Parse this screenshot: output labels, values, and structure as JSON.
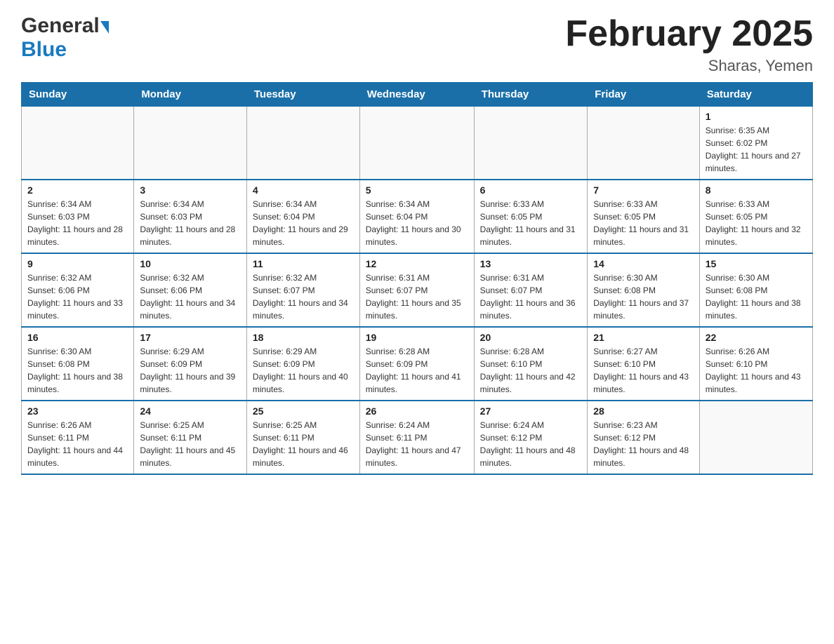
{
  "header": {
    "logo_general": "General",
    "logo_blue": "Blue",
    "month_title": "February 2025",
    "location": "Sharas, Yemen"
  },
  "days_of_week": [
    "Sunday",
    "Monday",
    "Tuesday",
    "Wednesday",
    "Thursday",
    "Friday",
    "Saturday"
  ],
  "weeks": [
    [
      {
        "num": "",
        "sunrise": "",
        "sunset": "",
        "daylight": ""
      },
      {
        "num": "",
        "sunrise": "",
        "sunset": "",
        "daylight": ""
      },
      {
        "num": "",
        "sunrise": "",
        "sunset": "",
        "daylight": ""
      },
      {
        "num": "",
        "sunrise": "",
        "sunset": "",
        "daylight": ""
      },
      {
        "num": "",
        "sunrise": "",
        "sunset": "",
        "daylight": ""
      },
      {
        "num": "",
        "sunrise": "",
        "sunset": "",
        "daylight": ""
      },
      {
        "num": "1",
        "sunrise": "Sunrise: 6:35 AM",
        "sunset": "Sunset: 6:02 PM",
        "daylight": "Daylight: 11 hours and 27 minutes."
      }
    ],
    [
      {
        "num": "2",
        "sunrise": "Sunrise: 6:34 AM",
        "sunset": "Sunset: 6:03 PM",
        "daylight": "Daylight: 11 hours and 28 minutes."
      },
      {
        "num": "3",
        "sunrise": "Sunrise: 6:34 AM",
        "sunset": "Sunset: 6:03 PM",
        "daylight": "Daylight: 11 hours and 28 minutes."
      },
      {
        "num": "4",
        "sunrise": "Sunrise: 6:34 AM",
        "sunset": "Sunset: 6:04 PM",
        "daylight": "Daylight: 11 hours and 29 minutes."
      },
      {
        "num": "5",
        "sunrise": "Sunrise: 6:34 AM",
        "sunset": "Sunset: 6:04 PM",
        "daylight": "Daylight: 11 hours and 30 minutes."
      },
      {
        "num": "6",
        "sunrise": "Sunrise: 6:33 AM",
        "sunset": "Sunset: 6:05 PM",
        "daylight": "Daylight: 11 hours and 31 minutes."
      },
      {
        "num": "7",
        "sunrise": "Sunrise: 6:33 AM",
        "sunset": "Sunset: 6:05 PM",
        "daylight": "Daylight: 11 hours and 31 minutes."
      },
      {
        "num": "8",
        "sunrise": "Sunrise: 6:33 AM",
        "sunset": "Sunset: 6:05 PM",
        "daylight": "Daylight: 11 hours and 32 minutes."
      }
    ],
    [
      {
        "num": "9",
        "sunrise": "Sunrise: 6:32 AM",
        "sunset": "Sunset: 6:06 PM",
        "daylight": "Daylight: 11 hours and 33 minutes."
      },
      {
        "num": "10",
        "sunrise": "Sunrise: 6:32 AM",
        "sunset": "Sunset: 6:06 PM",
        "daylight": "Daylight: 11 hours and 34 minutes."
      },
      {
        "num": "11",
        "sunrise": "Sunrise: 6:32 AM",
        "sunset": "Sunset: 6:07 PM",
        "daylight": "Daylight: 11 hours and 34 minutes."
      },
      {
        "num": "12",
        "sunrise": "Sunrise: 6:31 AM",
        "sunset": "Sunset: 6:07 PM",
        "daylight": "Daylight: 11 hours and 35 minutes."
      },
      {
        "num": "13",
        "sunrise": "Sunrise: 6:31 AM",
        "sunset": "Sunset: 6:07 PM",
        "daylight": "Daylight: 11 hours and 36 minutes."
      },
      {
        "num": "14",
        "sunrise": "Sunrise: 6:30 AM",
        "sunset": "Sunset: 6:08 PM",
        "daylight": "Daylight: 11 hours and 37 minutes."
      },
      {
        "num": "15",
        "sunrise": "Sunrise: 6:30 AM",
        "sunset": "Sunset: 6:08 PM",
        "daylight": "Daylight: 11 hours and 38 minutes."
      }
    ],
    [
      {
        "num": "16",
        "sunrise": "Sunrise: 6:30 AM",
        "sunset": "Sunset: 6:08 PM",
        "daylight": "Daylight: 11 hours and 38 minutes."
      },
      {
        "num": "17",
        "sunrise": "Sunrise: 6:29 AM",
        "sunset": "Sunset: 6:09 PM",
        "daylight": "Daylight: 11 hours and 39 minutes."
      },
      {
        "num": "18",
        "sunrise": "Sunrise: 6:29 AM",
        "sunset": "Sunset: 6:09 PM",
        "daylight": "Daylight: 11 hours and 40 minutes."
      },
      {
        "num": "19",
        "sunrise": "Sunrise: 6:28 AM",
        "sunset": "Sunset: 6:09 PM",
        "daylight": "Daylight: 11 hours and 41 minutes."
      },
      {
        "num": "20",
        "sunrise": "Sunrise: 6:28 AM",
        "sunset": "Sunset: 6:10 PM",
        "daylight": "Daylight: 11 hours and 42 minutes."
      },
      {
        "num": "21",
        "sunrise": "Sunrise: 6:27 AM",
        "sunset": "Sunset: 6:10 PM",
        "daylight": "Daylight: 11 hours and 43 minutes."
      },
      {
        "num": "22",
        "sunrise": "Sunrise: 6:26 AM",
        "sunset": "Sunset: 6:10 PM",
        "daylight": "Daylight: 11 hours and 43 minutes."
      }
    ],
    [
      {
        "num": "23",
        "sunrise": "Sunrise: 6:26 AM",
        "sunset": "Sunset: 6:11 PM",
        "daylight": "Daylight: 11 hours and 44 minutes."
      },
      {
        "num": "24",
        "sunrise": "Sunrise: 6:25 AM",
        "sunset": "Sunset: 6:11 PM",
        "daylight": "Daylight: 11 hours and 45 minutes."
      },
      {
        "num": "25",
        "sunrise": "Sunrise: 6:25 AM",
        "sunset": "Sunset: 6:11 PM",
        "daylight": "Daylight: 11 hours and 46 minutes."
      },
      {
        "num": "26",
        "sunrise": "Sunrise: 6:24 AM",
        "sunset": "Sunset: 6:11 PM",
        "daylight": "Daylight: 11 hours and 47 minutes."
      },
      {
        "num": "27",
        "sunrise": "Sunrise: 6:24 AM",
        "sunset": "Sunset: 6:12 PM",
        "daylight": "Daylight: 11 hours and 48 minutes."
      },
      {
        "num": "28",
        "sunrise": "Sunrise: 6:23 AM",
        "sunset": "Sunset: 6:12 PM",
        "daylight": "Daylight: 11 hours and 48 minutes."
      },
      {
        "num": "",
        "sunrise": "",
        "sunset": "",
        "daylight": ""
      }
    ]
  ]
}
